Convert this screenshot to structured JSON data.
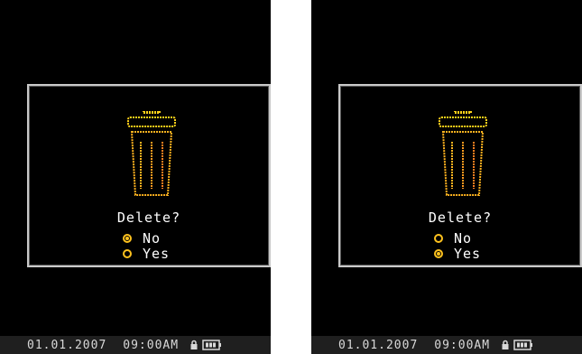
{
  "screens": [
    {
      "dialog": {
        "prompt": "Delete?",
        "options": [
          {
            "label": "No",
            "selected": true
          },
          {
            "label": "Yes",
            "selected": false
          }
        ]
      },
      "status": {
        "date": "01.01.2007",
        "time": "09:00AM",
        "icons": [
          "lock-icon",
          "battery-icon"
        ]
      }
    },
    {
      "dialog": {
        "prompt": "Delete?",
        "options": [
          {
            "label": "No",
            "selected": false
          },
          {
            "label": "Yes",
            "selected": true
          }
        ]
      },
      "status": {
        "date": "01.01.2007",
        "time": "09:00AM",
        "icons": [
          "lock-icon",
          "battery-icon"
        ]
      }
    }
  ],
  "colors": {
    "background": "#000000",
    "border": "#c9c9c9",
    "accent": "#ffc21e",
    "trash_top": "#ffd21a",
    "trash_bottom": "#ff5a1a",
    "statusbar": "#1f1f1f"
  }
}
